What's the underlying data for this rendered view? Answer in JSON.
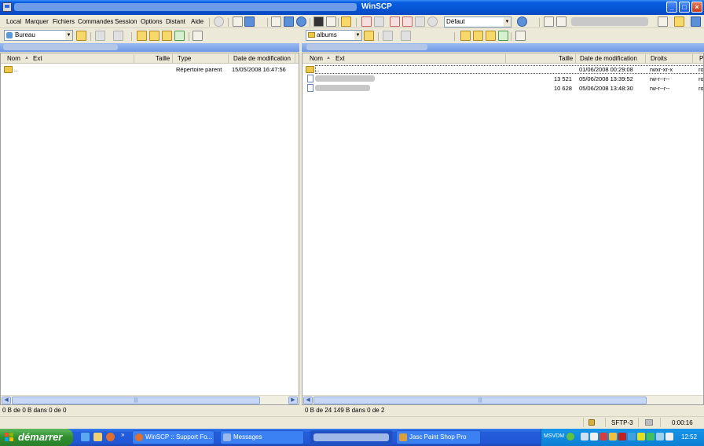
{
  "window": {
    "title": "WinSCP",
    "controls": {
      "minimize": "_",
      "maximize": "□",
      "close": "×"
    }
  },
  "menu": [
    "Local",
    "Marquer",
    "Fichiers",
    "Commandes",
    "Session",
    "Options",
    "Distant",
    "Aide"
  ],
  "toolbar": {
    "transfer_profile": "Défaut",
    "colors": {
      "accent": "#0554d6",
      "path_bar": "#6f98e6"
    }
  },
  "left": {
    "location": "Bureau",
    "columns": [
      "Nom",
      "Ext",
      "Taille",
      "Type",
      "Date de modification"
    ],
    "rows": [
      {
        "name": "..",
        "size": "",
        "type": "Répertoire parent",
        "modified": "15/05/2008  16:47:56",
        "icon": "parent-folder-icon"
      }
    ],
    "status": "0 B de 0 B dans 0 de 0"
  },
  "right": {
    "location": "albums",
    "columns": [
      "Nom",
      "Ext",
      "Taille",
      "Date de modification",
      "Droits",
      "P"
    ],
    "rows": [
      {
        "name": "..",
        "size": "",
        "modified": "01/06/2008 00:29:08",
        "rights": "rwxr-xr-x",
        "owner": "ro",
        "icon": "parent-folder-icon"
      },
      {
        "name": "",
        "size": "13 521",
        "modified": "05/06/2008 13:39:52",
        "rights": "rw-r--r--",
        "owner": "ro",
        "icon": "file-icon"
      },
      {
        "name": "",
        "size": "10 628",
        "modified": "05/06/2008 13:48:30",
        "rights": "rw-r--r--",
        "owner": "ro",
        "icon": "file-icon"
      }
    ],
    "status": "0 B de 24 149 B dans 0 de 2"
  },
  "statusbar": {
    "protocol": "SFTP-3",
    "elapsed": "0:00:16"
  },
  "taskbar": {
    "start_label": "démarrer",
    "tasks": [
      "WinSCP :: Support Fo...",
      "Messages",
      "",
      "Jasc Paint Shop Pro"
    ],
    "tray_label": "MSVDM",
    "clock": "12:52"
  }
}
